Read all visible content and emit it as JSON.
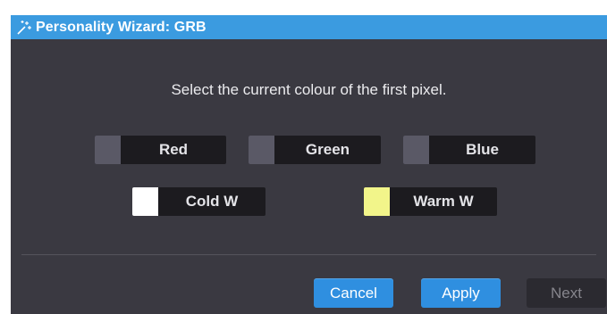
{
  "window": {
    "title": "Personality Wizard: GRB",
    "icon": "wizard-wand-icon"
  },
  "prompt": "Select the current colour of the first pixel.",
  "colour_options": [
    {
      "label": "Red",
      "swatch_color": "#5a5966"
    },
    {
      "label": "Green",
      "swatch_color": "#5a5966"
    },
    {
      "label": "Blue",
      "swatch_color": "#5a5966"
    },
    {
      "label": "Cold W",
      "swatch_color": "#ffffff"
    },
    {
      "label": "Warm W",
      "swatch_color": "#f2f58a"
    }
  ],
  "buttons": {
    "cancel": "Cancel",
    "apply": "Apply",
    "next": "Next"
  },
  "colors": {
    "titlebar": "#3b9be0",
    "window_bg": "#3a3941",
    "primary_button": "#2f8fe0"
  }
}
